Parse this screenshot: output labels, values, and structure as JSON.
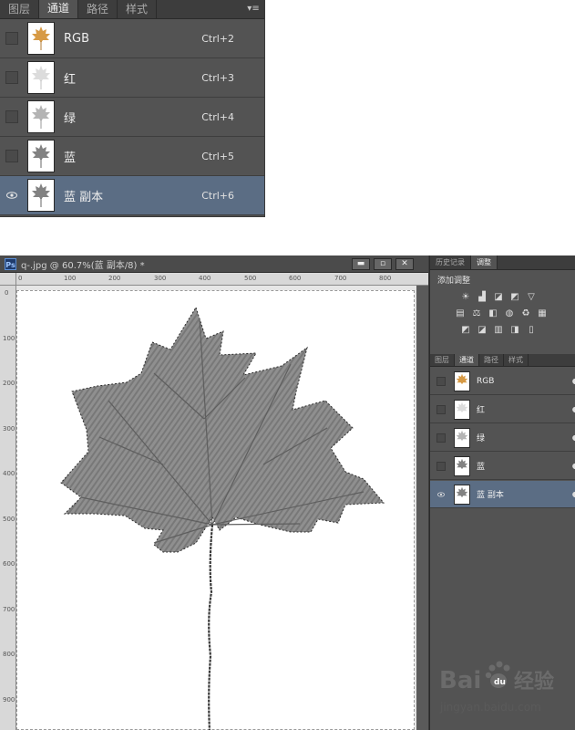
{
  "top_panel": {
    "tabs": [
      {
        "label": "图层"
      },
      {
        "label": "通道"
      },
      {
        "label": "路径"
      },
      {
        "label": "样式"
      }
    ],
    "menu_icon": "panel-menu-icon",
    "channels": [
      {
        "name": "RGB",
        "shortcut": "Ctrl+2",
        "thumb_color": "#d79a45",
        "visible": false,
        "selected": false
      },
      {
        "name": "红",
        "shortcut": "Ctrl+3",
        "thumb_color": "#dcdcdc",
        "visible": false,
        "selected": false
      },
      {
        "name": "绿",
        "shortcut": "Ctrl+4",
        "thumb_color": "#b4b4b4",
        "visible": false,
        "selected": false
      },
      {
        "name": "蓝",
        "shortcut": "Ctrl+5",
        "thumb_color": "#828282",
        "visible": false,
        "selected": false
      },
      {
        "name": "蓝 副本",
        "shortcut": "Ctrl+6",
        "thumb_color": "#828282",
        "visible": true,
        "selected": true
      }
    ]
  },
  "window": {
    "title": "q-.jpg @ 60.7%(蓝 副本/8) *",
    "ps_badge": "Ps",
    "buttons": {
      "minimize": "▬",
      "restore": "▫",
      "close": "✕"
    },
    "ruler_top_labels": [
      "0",
      "100",
      "200",
      "300",
      "400",
      "500",
      "600",
      "700",
      "800"
    ],
    "ruler_left_labels": [
      "0",
      "100",
      "200",
      "300",
      "400",
      "500",
      "600",
      "700",
      "800",
      "900"
    ]
  },
  "dock": {
    "tabs": [
      {
        "label": "历史记录"
      },
      {
        "label": "调整"
      }
    ],
    "adjust_title": "添加调整",
    "adjust_icons_row1": [
      "☀",
      "▟",
      "◪",
      "◩",
      "▽"
    ],
    "adjust_icons_row2": [
      "▤",
      "⚖",
      "◧",
      "◍",
      "♻",
      "▦"
    ],
    "adjust_icons_row3": [
      "◩",
      "◪",
      "▥",
      "◨",
      "▯"
    ],
    "channel_tabs": [
      {
        "label": "图层"
      },
      {
        "label": "通道"
      },
      {
        "label": "路径"
      },
      {
        "label": "样式"
      }
    ],
    "channels": [
      {
        "name": "RGB",
        "thumb_color": "#d79a45"
      },
      {
        "name": "红",
        "thumb_color": "#dcdcdc"
      },
      {
        "name": "绿",
        "thumb_color": "#b4b4b4"
      },
      {
        "name": "蓝",
        "thumb_color": "#828282"
      },
      {
        "name": "蓝 副本",
        "thumb_color": "#828282"
      }
    ]
  },
  "watermark": {
    "brand": "Bai",
    "brand_suffix": "经验",
    "url": "jingyan.baidu.com"
  }
}
